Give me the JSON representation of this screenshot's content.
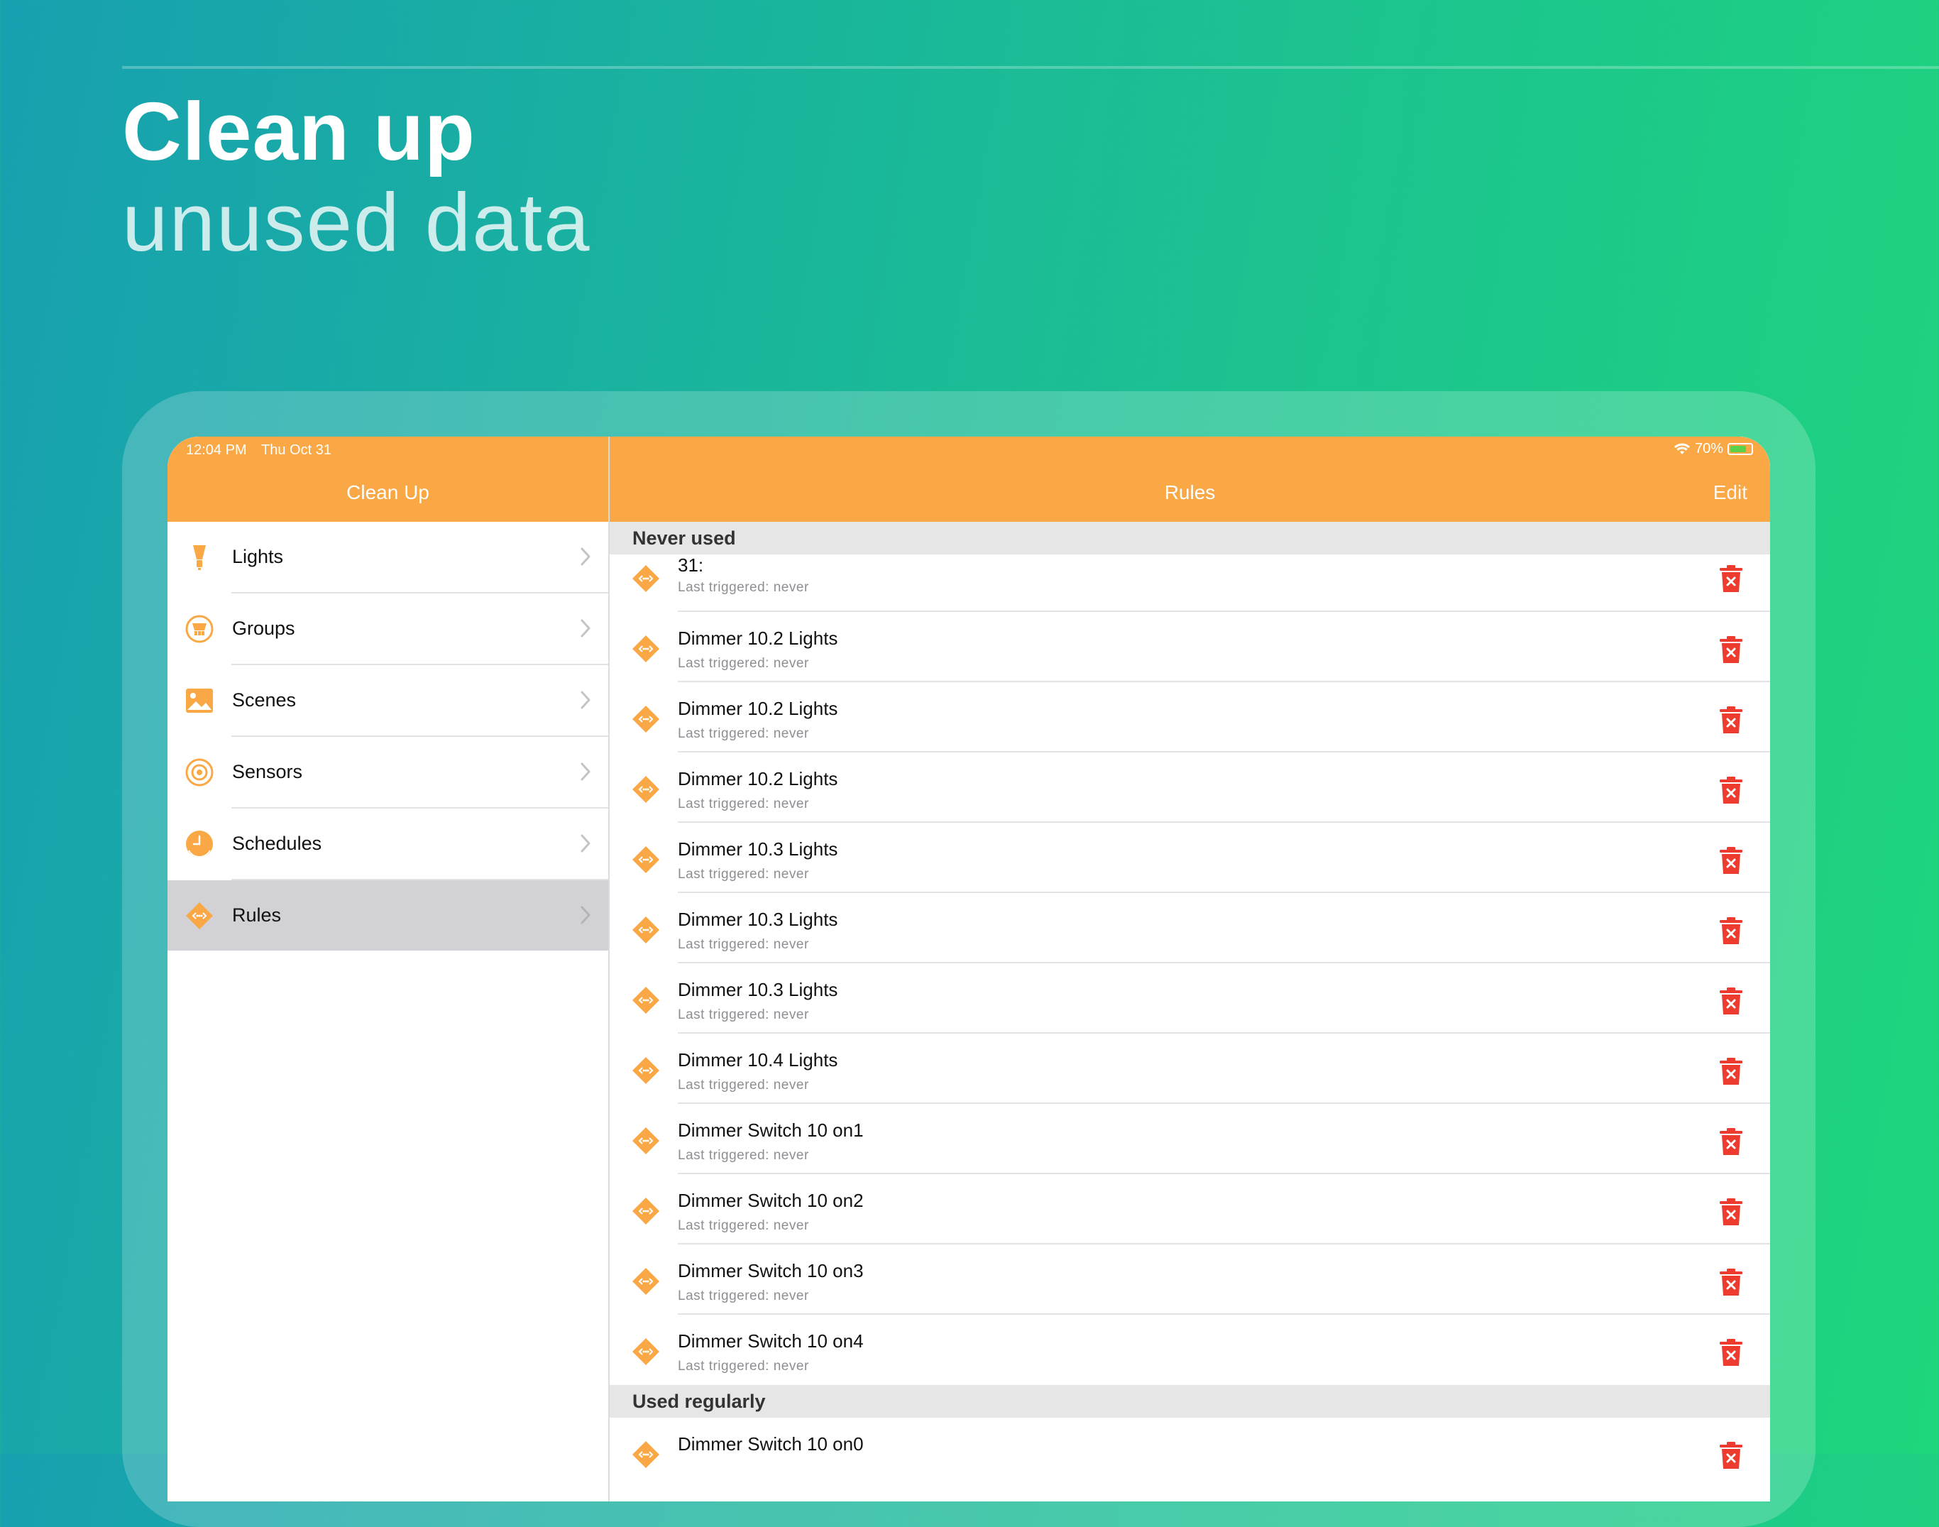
{
  "headline": {
    "title": "Clean up",
    "subtitle": "unused data"
  },
  "status_bar": {
    "time": "12:04 PM",
    "date": "Thu Oct 31",
    "battery": "70%"
  },
  "sidebar": {
    "title": "Clean Up",
    "items": [
      {
        "label": "Lights",
        "icon": "light-bulb-icon"
      },
      {
        "label": "Groups",
        "icon": "groups-icon"
      },
      {
        "label": "Scenes",
        "icon": "scenes-image-icon"
      },
      {
        "label": "Sensors",
        "icon": "sensor-target-icon"
      },
      {
        "label": "Schedules",
        "icon": "clock-icon"
      },
      {
        "label": "Rules",
        "icon": "rule-diamond-icon",
        "selected": true
      }
    ]
  },
  "detail": {
    "title": "Rules",
    "edit_label": "Edit",
    "sections": [
      {
        "header": "Never used",
        "rows": [
          {
            "title": "31:",
            "subtitle": "Last triggered: never"
          },
          {
            "title": "Dimmer 10.2 Lights",
            "subtitle": "Last triggered: never"
          },
          {
            "title": "Dimmer 10.2 Lights",
            "subtitle": "Last triggered: never"
          },
          {
            "title": "Dimmer 10.2 Lights",
            "subtitle": "Last triggered: never"
          },
          {
            "title": "Dimmer 10.3 Lights",
            "subtitle": "Last triggered: never"
          },
          {
            "title": "Dimmer 10.3 Lights",
            "subtitle": "Last triggered: never"
          },
          {
            "title": "Dimmer 10.3 Lights",
            "subtitle": "Last triggered: never"
          },
          {
            "title": "Dimmer 10.4 Lights",
            "subtitle": "Last triggered: never"
          },
          {
            "title": "Dimmer Switch 10 on1",
            "subtitle": "Last triggered: never"
          },
          {
            "title": "Dimmer Switch 10 on2",
            "subtitle": "Last triggered: never"
          },
          {
            "title": "Dimmer Switch 10 on3",
            "subtitle": "Last triggered: never"
          },
          {
            "title": "Dimmer Switch 10 on4",
            "subtitle": "Last triggered: never"
          }
        ]
      },
      {
        "header": "Used regularly",
        "rows": [
          {
            "title": "Dimmer Switch 10 on0"
          }
        ]
      }
    ]
  },
  "colors": {
    "accent_orange": "#f9a845",
    "delete_red": "#ee3b2f",
    "selection_gray": "#d1d1d6"
  }
}
